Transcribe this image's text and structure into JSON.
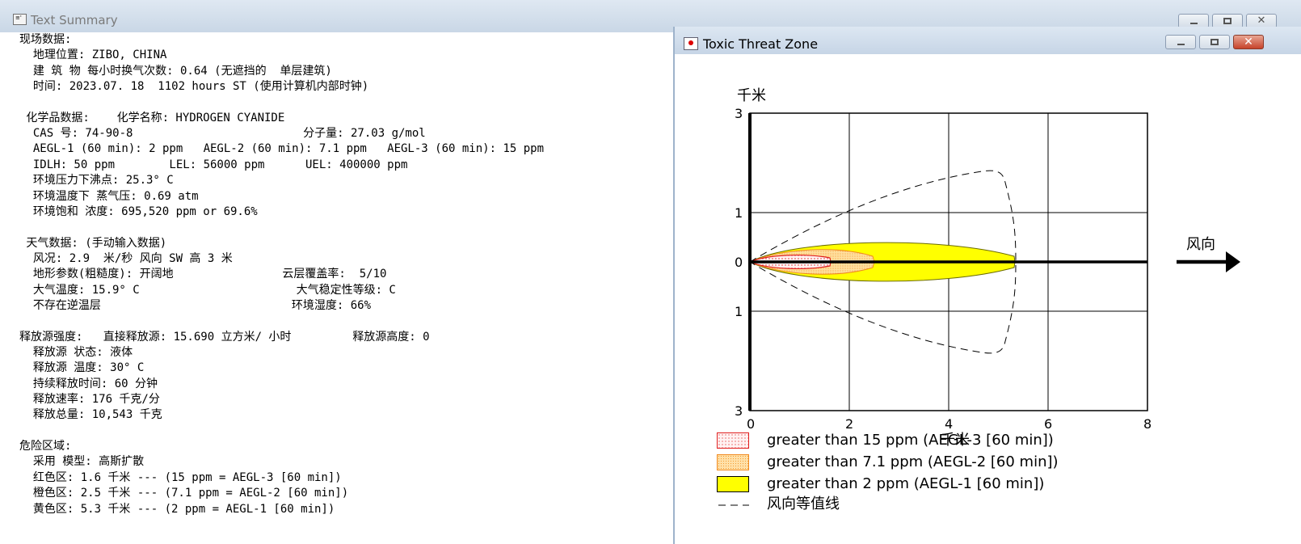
{
  "main_window": {
    "title": "Text Summary",
    "lines": [
      "现场数据:",
      "  地理位置: ZIBO, CHINA",
      "  建 筑 物 每小时换气次数: 0.64 (无遮挡的  单层建筑)",
      "  时间: 2023.07. 18  1102 hours ST (使用计算机内部时钟)",
      "",
      " 化学品数据:    化学名称: HYDROGEN CYANIDE",
      "  CAS 号: 74-90-8                         分子量: 27.03 g/mol",
      "  AEGL-1 (60 min): 2 ppm   AEGL-2 (60 min): 7.1 ppm   AEGL-3 (60 min): 15 ppm",
      "  IDLH: 50 ppm        LEL: 56000 ppm      UEL: 400000 ppm",
      "  环境压力下沸点: 25.3° C",
      "  环境温度下 蒸气压: 0.69 atm",
      "  环境饱和 浓度: 695,520 ppm or 69.6%",
      "",
      " 天气数据: (手动输入数据)",
      "  风况: 2.9  米/秒 风向 SW 高 3 米",
      "  地形参数(粗糙度): 开阔地                云层覆盖率:  5/10",
      "  大气温度: 15.9° C                       大气稳定性等级: C",
      "  不存在逆温层                            环境湿度: 66%",
      "",
      "释放源强度:   直接释放源: 15.690 立方米/ 小时         释放源高度: 0",
      "  释放源 状态: 液体",
      "  释放源 温度: 30° C",
      "  持续释放时间: 60 分钟",
      "  释放速率: 176 千克/分",
      "  释放总量: 10,543 千克",
      "",
      "危险区域:",
      "  采用 模型: 高斯扩散",
      "  红色区: 1.6 千米 --- (15 ppm = AEGL-3 [60 min])",
      "  橙色区: 2.5 千米 --- (7.1 ppm = AEGL-2 [60 min])",
      "  黄色区: 5.3 千米 --- (2 ppm = AEGL-1 [60 min])"
    ]
  },
  "threat_window": {
    "title": "Toxic Threat Zone",
    "y_axis_unit": "千米",
    "x_axis_unit": "千米",
    "y_tick_labels": [
      "3",
      "1",
      "0",
      "1",
      "3"
    ],
    "x_tick_labels": [
      "0",
      "2",
      "4",
      "6",
      "8"
    ],
    "wind_label": "风向",
    "legend": [
      {
        "text": "greater than 15 ppm (AEGL-3 [60 min])"
      },
      {
        "text": "greater than 7.1 ppm (AEGL-2 [60 min])"
      },
      {
        "text": "greater than 2 ppm (AEGL-1 [60 min])"
      },
      {
        "text": "风向等值线"
      }
    ]
  },
  "zones": [
    {
      "name": "red",
      "length_km": 1.6,
      "color": "#e8202a"
    },
    {
      "name": "orange",
      "length_km": 2.5,
      "color": "#f5a623"
    },
    {
      "name": "yellow",
      "length_km": 5.3,
      "color": "#ffff00"
    }
  ],
  "colors": {
    "titlebar": "#d3dfec",
    "close_button": "#c7432a"
  }
}
